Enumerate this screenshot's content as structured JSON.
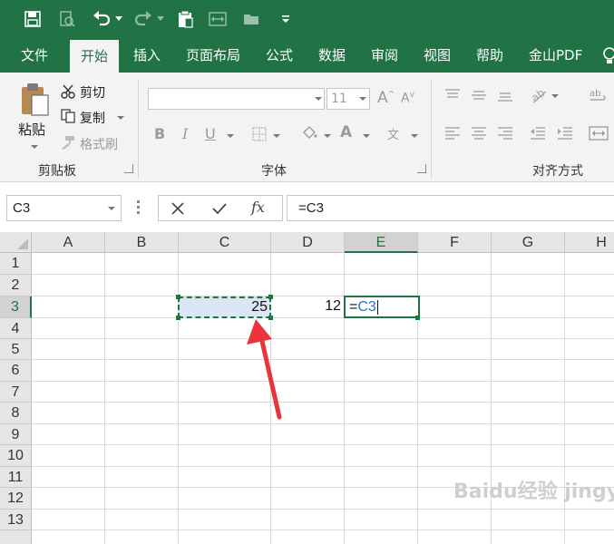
{
  "ribbon_tabs": [
    "文件",
    "开始",
    "插入",
    "页面布局",
    "公式",
    "数据",
    "审阅",
    "视图",
    "帮助",
    "金山PDF"
  ],
  "active_tab": "开始",
  "clipboard": {
    "paste": "粘贴",
    "cut": "剪切",
    "copy": "复制",
    "format_painter": "格式刷",
    "group_label": "剪贴板"
  },
  "font_group": {
    "font_size": "11",
    "group_label": "字体",
    "bold": "B",
    "italic": "I",
    "underline": "U",
    "font_color": "A",
    "phonetic": "文"
  },
  "align_group": {
    "group_label": "对齐方式"
  },
  "formula_bar": {
    "name_box": "C3",
    "formula": "=C3",
    "fx": "fx"
  },
  "columns": [
    "A",
    "B",
    "C",
    "D",
    "E",
    "F",
    "G",
    "H"
  ],
  "rows": [
    "1",
    "2",
    "3",
    "4",
    "5",
    "6",
    "7",
    "8",
    "9",
    "10",
    "11",
    "12",
    "13"
  ],
  "cells": {
    "C3": "25",
    "D3": "12",
    "E3_eq": "=",
    "E3_ref": "C3"
  },
  "watermark": "Baidu经验 jingyan.baidu.com",
  "colors": {
    "excel_green": "#217346",
    "ribbon_bg": "#f3f3f3",
    "copy_fill": "#dbe6f5",
    "arrow_red": "#e8343a",
    "ref_blue": "#2f6fcf"
  }
}
